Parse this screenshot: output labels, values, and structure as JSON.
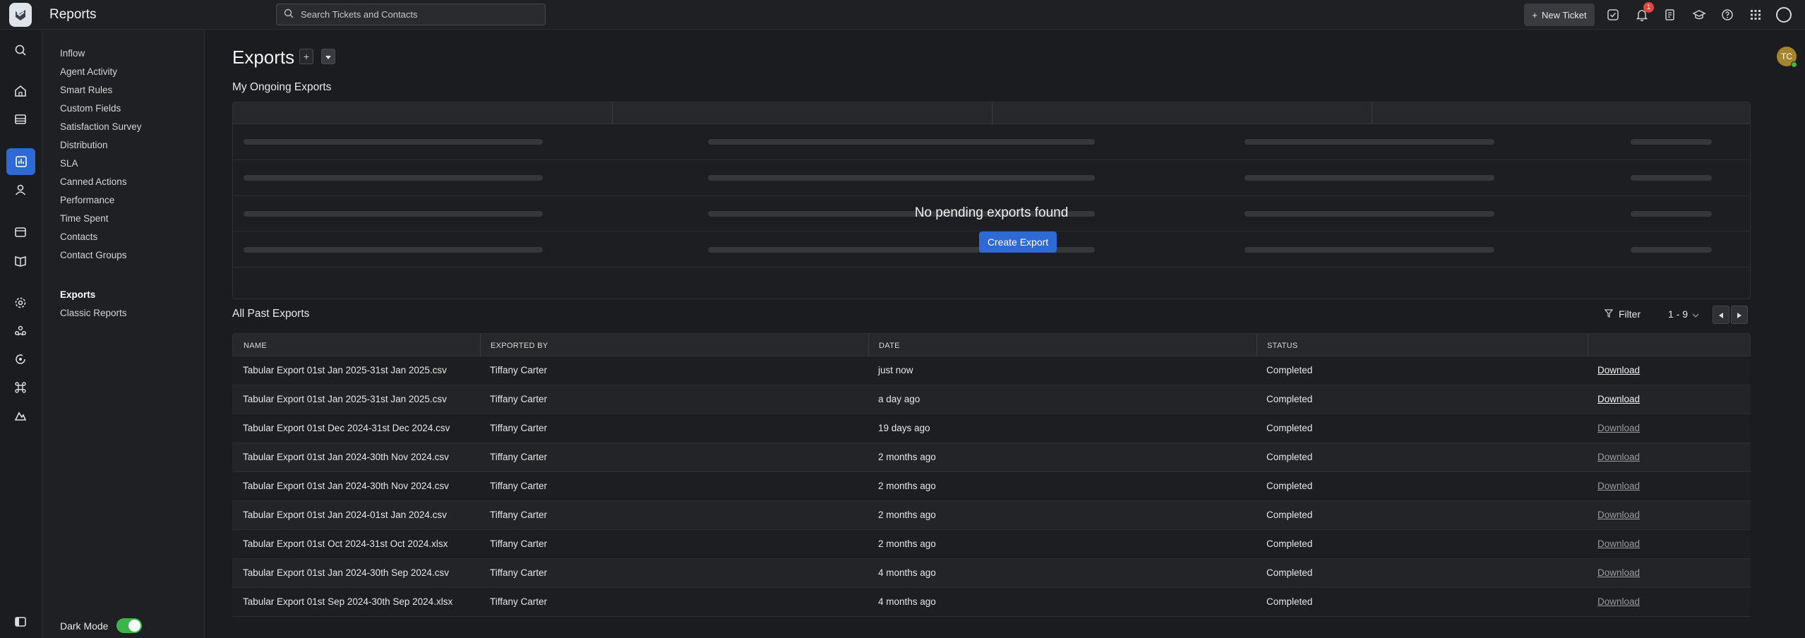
{
  "app": {
    "title": "Reports"
  },
  "search": {
    "placeholder": "Search Tickets and Contacts"
  },
  "header": {
    "new_ticket_label": "New Ticket",
    "notification_count": "1"
  },
  "nav": {
    "items": [
      "Inflow",
      "Agent Activity",
      "Smart Rules",
      "Custom Fields",
      "Satisfaction Survey",
      "Distribution",
      "SLA",
      "Canned Actions",
      "Performance",
      "Time Spent",
      "Contacts",
      "Contact Groups"
    ],
    "exports": "Exports",
    "classic": "Classic Reports",
    "dark_mode_label": "Dark Mode",
    "dark_mode_on": true
  },
  "page": {
    "title": "Exports",
    "ongoing_title": "My Ongoing Exports",
    "empty_message": "No pending exports found",
    "create_export": "Create Export",
    "past_title": "All Past Exports",
    "filter_label": "Filter",
    "pagination_label": "1 - 9"
  },
  "table": {
    "headers": [
      "NAME",
      "EXPORTED BY",
      "DATE",
      "STATUS"
    ],
    "download_label": "Download",
    "rows": [
      {
        "name": "Tabular Export 01st Jan 2025-31st Jan 2025.csv",
        "by": "Tiffany Carter",
        "date": "just now",
        "status": "Completed"
      },
      {
        "name": "Tabular Export 01st Jan 2025-31st Jan 2025.csv",
        "by": "Tiffany Carter",
        "date": "a day ago",
        "status": "Completed"
      },
      {
        "name": "Tabular Export 01st Dec 2024-31st Dec 2024.csv",
        "by": "Tiffany Carter",
        "date": "19 days ago",
        "status": "Completed"
      },
      {
        "name": "Tabular Export 01st Jan 2024-30th Nov 2024.csv",
        "by": "Tiffany Carter",
        "date": "2 months ago",
        "status": "Completed"
      },
      {
        "name": "Tabular Export 01st Jan 2024-30th Nov 2024.csv",
        "by": "Tiffany Carter",
        "date": "2 months ago",
        "status": "Completed"
      },
      {
        "name": "Tabular Export 01st Jan 2024-01st Jan 2024.csv",
        "by": "Tiffany Carter",
        "date": "2 months ago",
        "status": "Completed"
      },
      {
        "name": "Tabular Export 01st Oct 2024-31st Oct 2024.xlsx",
        "by": "Tiffany Carter",
        "date": "2 months ago",
        "status": "Completed"
      },
      {
        "name": "Tabular Export 01st Jan 2024-30th Sep 2024.csv",
        "by": "Tiffany Carter",
        "date": "4 months ago",
        "status": "Completed"
      },
      {
        "name": "Tabular Export 01st Sep 2024-30th Sep 2024.xlsx",
        "by": "Tiffany Carter",
        "date": "4 months ago",
        "status": "Completed"
      }
    ]
  },
  "user": {
    "initials": "TC"
  },
  "colors": {
    "accent": "#2e6ad6",
    "toggle_on": "#3bb54a",
    "badge": "#e0463d"
  }
}
